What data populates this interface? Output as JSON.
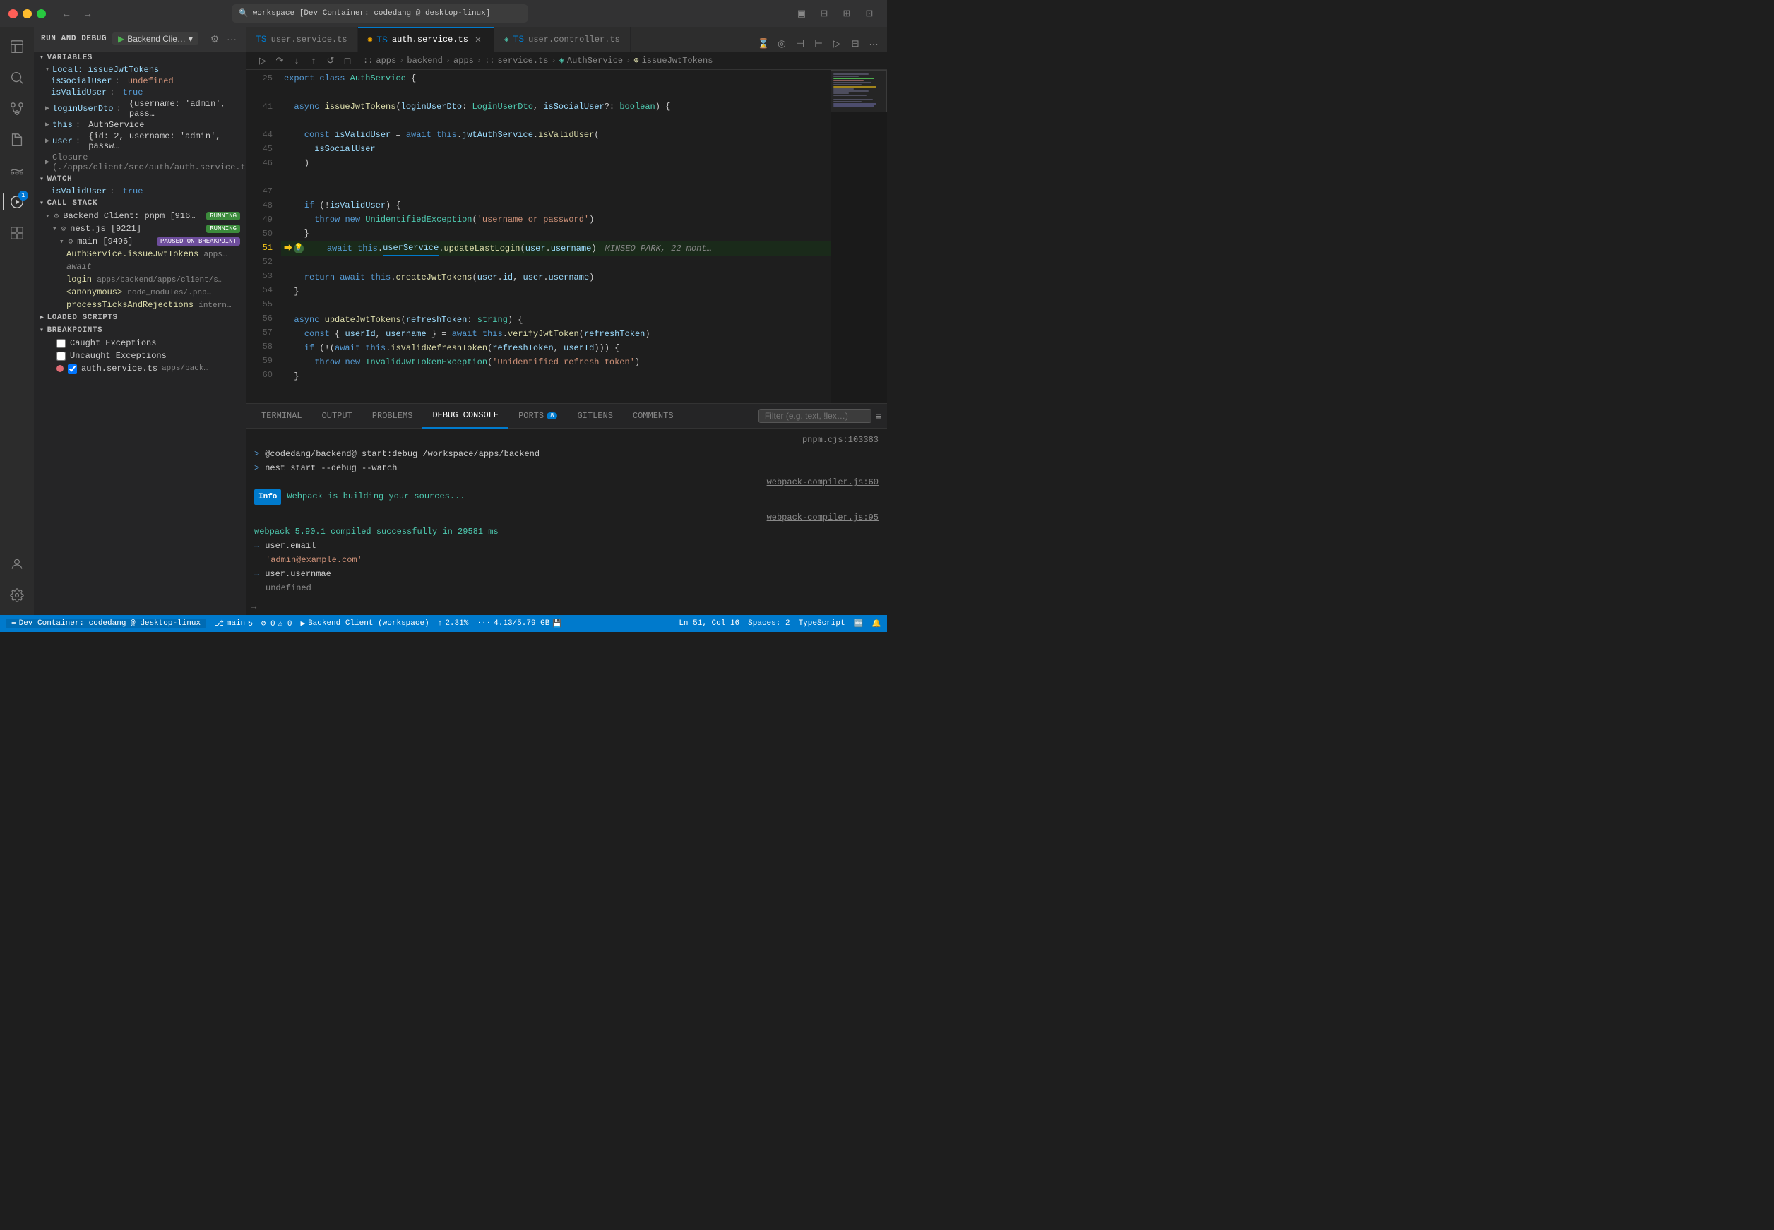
{
  "titlebar": {
    "search_text": "workspace [Dev Container: codedang @ desktop-linux]",
    "nav_back": "←",
    "nav_forward": "→"
  },
  "activity_bar": {
    "icons": [
      {
        "name": "explorer",
        "symbol": "⎘",
        "active": false
      },
      {
        "name": "search",
        "symbol": "🔍",
        "active": false
      },
      {
        "name": "source-control",
        "symbol": "⎇",
        "active": false
      },
      {
        "name": "extensions",
        "symbol": "⊞",
        "active": false
      },
      {
        "name": "testing",
        "symbol": "⚗",
        "active": false
      },
      {
        "name": "docker",
        "symbol": "🐳",
        "active": false
      },
      {
        "name": "run-debug",
        "symbol": "▶",
        "active": true,
        "badge": null
      },
      {
        "name": "extensions2",
        "symbol": "⊡",
        "active": false
      }
    ],
    "bottom_icons": [
      {
        "name": "account",
        "symbol": "👤"
      },
      {
        "name": "settings",
        "symbol": "⚙"
      }
    ]
  },
  "sidebar": {
    "run_debug_label": "RUN AND DEBUG",
    "debug_config": "Backend Clie…",
    "sections": {
      "variables": {
        "title": "VARIABLES",
        "local_title": "Local: issueJwtTokens",
        "items": [
          {
            "name": "isSocialUser",
            "value": "undefined"
          },
          {
            "name": "isValidUser",
            "value": "true"
          },
          {
            "name": "loginUserDto",
            "value": "{username: 'admin', pass…"
          },
          {
            "name": "this",
            "value": "AuthService"
          },
          {
            "name": "user",
            "value": "{id: 2, username: 'admin', passw…"
          },
          {
            "name": "Closure",
            "value": "(./apps/client/src/auth/auth.service.ts)"
          }
        ]
      },
      "watch": {
        "title": "WATCH",
        "items": [
          {
            "expr": "isValidUser",
            "value": "true"
          }
        ]
      },
      "call_stack": {
        "title": "CALL STACK",
        "items": [
          {
            "label": "Backend Client: pnpm [916…",
            "status": "RUNNING",
            "indent": 0
          },
          {
            "label": "nest.js [9221]",
            "status": "RUNNING",
            "indent": 1
          },
          {
            "label": "main [9496]",
            "status": "PAUSED ON BREAKPOINT",
            "indent": 2
          },
          {
            "label": "AuthService.issueJwtTokens",
            "loc": "apps…",
            "indent": 3
          },
          {
            "label": "await",
            "loc": "",
            "indent": 3,
            "italic": true
          },
          {
            "label": "login",
            "loc": "apps/backend/apps/client/s…",
            "indent": 3
          },
          {
            "label": "<anonymous>",
            "loc": "node_modules/.pnp…",
            "indent": 3
          },
          {
            "label": "processTicksAndRejections",
            "loc": "intern…",
            "indent": 3
          }
        ]
      },
      "loaded_scripts": {
        "title": "LOADED SCRIPTS"
      },
      "breakpoints": {
        "title": "BREAKPOINTS",
        "items": [
          {
            "label": "Caught Exceptions",
            "checked": false
          },
          {
            "label": "Uncaught Exceptions",
            "checked": false
          },
          {
            "label": "auth.service.ts",
            "loc": "apps/back…",
            "has_dot": true,
            "checked": true
          }
        ]
      }
    }
  },
  "editor": {
    "tabs": [
      {
        "label": "user.service.ts",
        "active": false,
        "icon": "ts"
      },
      {
        "label": "auth.service.ts",
        "active": true,
        "icon": "ts",
        "modified": false
      },
      {
        "label": "user.controller.ts",
        "active": false,
        "icon": "ts"
      }
    ],
    "breadcrumb": [
      "apps",
      "backend",
      "apps",
      "service.ts",
      "AuthService",
      "issueJwtTokens"
    ],
    "lines": [
      {
        "num": 25,
        "content": "export class AuthService {",
        "tokens": [
          {
            "t": "kw",
            "v": "export"
          },
          {
            "t": "op",
            "v": " "
          },
          {
            "t": "kw",
            "v": "class"
          },
          {
            "t": "op",
            "v": " "
          },
          {
            "t": "cls",
            "v": "AuthService"
          },
          {
            "t": "op",
            "v": " {"
          }
        ]
      },
      {
        "num": 41,
        "content": "  async issueJwtTokens(loginUserDto: LoginUserDto, isSocialUser?: boolean) {",
        "tokens": [
          {
            "t": "op",
            "v": "  "
          },
          {
            "t": "kw",
            "v": "async"
          },
          {
            "t": "op",
            "v": " "
          },
          {
            "t": "fn",
            "v": "issueJwtTokens"
          },
          {
            "t": "op",
            "v": "("
          },
          {
            "t": "param",
            "v": "loginUserDto"
          },
          {
            "t": "op",
            "v": ": "
          },
          {
            "t": "type",
            "v": "LoginUserDto"
          },
          {
            "t": "op",
            "v": ", "
          },
          {
            "t": "param",
            "v": "isSocialUser"
          },
          {
            "t": "op",
            "v": "?: "
          },
          {
            "t": "type",
            "v": "boolean"
          },
          {
            "t": "op",
            "v": ") {"
          }
        ]
      },
      {
        "num": 44,
        "content": "    const isValidUser = await this.jwtAuthService.isValidUser(",
        "tokens": [
          {
            "t": "op",
            "v": "    "
          },
          {
            "t": "kw",
            "v": "const"
          },
          {
            "t": "op",
            "v": " "
          },
          {
            "t": "prop",
            "v": "isValidUser"
          },
          {
            "t": "op",
            "v": " = "
          },
          {
            "t": "kw",
            "v": "await"
          },
          {
            "t": "op",
            "v": " "
          },
          {
            "t": "kw",
            "v": "this"
          },
          {
            "t": "op",
            "v": "."
          },
          {
            "t": "prop",
            "v": "jwtAuthService"
          },
          {
            "t": "op",
            "v": "."
          },
          {
            "t": "fn",
            "v": "isValidUser"
          },
          {
            "t": "op",
            "v": "("
          }
        ]
      },
      {
        "num": 45,
        "content": "      isSocialUser",
        "tokens": [
          {
            "t": "op",
            "v": "      "
          },
          {
            "t": "prop",
            "v": "isSocialUser"
          }
        ]
      },
      {
        "num": 46,
        "content": "    )",
        "tokens": [
          {
            "t": "op",
            "v": "    )"
          }
        ]
      },
      {
        "num": 47,
        "content": "",
        "tokens": []
      },
      {
        "num": 48,
        "content": "    if (!isValidUser) {",
        "tokens": [
          {
            "t": "op",
            "v": "    "
          },
          {
            "t": "kw",
            "v": "if"
          },
          {
            "t": "op",
            "v": " (!"
          },
          {
            "t": "prop",
            "v": "isValidUser"
          },
          {
            "t": "op",
            "v": ") {"
          }
        ]
      },
      {
        "num": 49,
        "content": "      throw new UnidentifiedException('username or password')",
        "tokens": [
          {
            "t": "op",
            "v": "      "
          },
          {
            "t": "kw",
            "v": "throw"
          },
          {
            "t": "op",
            "v": " "
          },
          {
            "t": "kw",
            "v": "new"
          },
          {
            "t": "op",
            "v": " "
          },
          {
            "t": "cls",
            "v": "UnidentifiedException"
          },
          {
            "t": "op",
            "v": "("
          },
          {
            "t": "str",
            "v": "'username or password'"
          },
          {
            "t": "op",
            "v": ")"
          }
        ]
      },
      {
        "num": 50,
        "content": "    }",
        "tokens": [
          {
            "t": "op",
            "v": "    }"
          }
        ]
      },
      {
        "num": 51,
        "content": "    await this.userService.updateLastLogin(user.username)",
        "breakpoint": true,
        "debug_line": true,
        "inline_hint": "MINSEO PARK, 22 mont…"
      },
      {
        "num": 52,
        "content": "",
        "tokens": []
      },
      {
        "num": 53,
        "content": "    return await this.createJwtTokens(user.id, user.username)",
        "tokens": [
          {
            "t": "op",
            "v": "    "
          },
          {
            "t": "kw",
            "v": "return"
          },
          {
            "t": "op",
            "v": " "
          },
          {
            "t": "kw",
            "v": "await"
          },
          {
            "t": "op",
            "v": " "
          },
          {
            "t": "kw",
            "v": "this"
          },
          {
            "t": "op",
            "v": "."
          },
          {
            "t": "fn",
            "v": "createJwtTokens"
          },
          {
            "t": "op",
            "v": "("
          },
          {
            "t": "prop",
            "v": "user"
          },
          {
            "t": "op",
            "v": "."
          },
          {
            "t": "prop",
            "v": "id"
          },
          {
            "t": "op",
            "v": ", "
          },
          {
            "t": "prop",
            "v": "user"
          },
          {
            "t": "op",
            "v": "."
          },
          {
            "t": "prop",
            "v": "username"
          },
          {
            "t": "op",
            "v": ")"
          }
        ]
      },
      {
        "num": 54,
        "content": "  }",
        "tokens": [
          {
            "t": "op",
            "v": "  }"
          }
        ]
      },
      {
        "num": 55,
        "content": "",
        "tokens": []
      },
      {
        "num": 56,
        "content": "  async updateJwtTokens(refreshToken: string) {",
        "tokens": [
          {
            "t": "op",
            "v": "  "
          },
          {
            "t": "kw",
            "v": "async"
          },
          {
            "t": "op",
            "v": " "
          },
          {
            "t": "fn",
            "v": "updateJwtTokens"
          },
          {
            "t": "op",
            "v": "("
          },
          {
            "t": "param",
            "v": "refreshToken"
          },
          {
            "t": "op",
            "v": ": "
          },
          {
            "t": "type",
            "v": "string"
          },
          {
            "t": "op",
            "v": ") {"
          }
        ]
      },
      {
        "num": 57,
        "content": "    const { userId, username } = await this.verifyJwtToken(refreshToken)",
        "tokens": [
          {
            "t": "op",
            "v": "    "
          },
          {
            "t": "kw",
            "v": "const"
          },
          {
            "t": "op",
            "v": " { "
          },
          {
            "t": "prop",
            "v": "userId"
          },
          {
            "t": "op",
            "v": ", "
          },
          {
            "t": "prop",
            "v": "username"
          },
          {
            "t": "op",
            "v": " } = "
          },
          {
            "t": "kw",
            "v": "await"
          },
          {
            "t": "op",
            "v": " "
          },
          {
            "t": "kw",
            "v": "this"
          },
          {
            "t": "op",
            "v": "."
          },
          {
            "t": "fn",
            "v": "verifyJwtToken"
          },
          {
            "t": "op",
            "v": "("
          },
          {
            "t": "prop",
            "v": "refreshToken"
          },
          {
            "t": "op",
            "v": ")"
          }
        ]
      },
      {
        "num": 58,
        "content": "    if (!(await this.isValidRefreshToken(refreshToken, userId))) {",
        "tokens": [
          {
            "t": "op",
            "v": "    "
          },
          {
            "t": "kw",
            "v": "if"
          },
          {
            "t": "op",
            "v": " (!("
          },
          {
            "t": "kw",
            "v": "await"
          },
          {
            "t": "op",
            "v": " "
          },
          {
            "t": "kw",
            "v": "this"
          },
          {
            "t": "op",
            "v": "."
          },
          {
            "t": "fn",
            "v": "isValidRefreshToken"
          },
          {
            "t": "op",
            "v": "("
          },
          {
            "t": "prop",
            "v": "refreshToken"
          },
          {
            "t": "op",
            "v": ", "
          },
          {
            "t": "prop",
            "v": "userId"
          },
          {
            "t": "op",
            "v": "))) {"
          }
        ]
      },
      {
        "num": 59,
        "content": "      throw new InvalidJwtTokenException('Unidentified refresh token')",
        "tokens": [
          {
            "t": "op",
            "v": "      "
          },
          {
            "t": "kw",
            "v": "throw"
          },
          {
            "t": "op",
            "v": " "
          },
          {
            "t": "kw",
            "v": "new"
          },
          {
            "t": "op",
            "v": " "
          },
          {
            "t": "cls",
            "v": "InvalidJwtTokenException"
          },
          {
            "t": "op",
            "v": "("
          },
          {
            "t": "str",
            "v": "'Unidentified refresh token'"
          },
          {
            "t": "op",
            "v": ")"
          }
        ]
      },
      {
        "num": 60,
        "content": "  }",
        "tokens": [
          {
            "t": "op",
            "v": "  }"
          }
        ]
      }
    ]
  },
  "panel": {
    "tabs": [
      {
        "label": "TERMINAL",
        "active": false
      },
      {
        "label": "OUTPUT",
        "active": false
      },
      {
        "label": "PROBLEMS",
        "active": false
      },
      {
        "label": "DEBUG CONSOLE",
        "active": true
      },
      {
        "label": "PORTS",
        "active": false,
        "badge": "8"
      },
      {
        "label": "GITLENS",
        "active": false
      },
      {
        "label": "COMMENTS",
        "active": false
      }
    ],
    "filter_placeholder": "Filter (e.g. text, !lex…)",
    "console_lines": [
      {
        "type": "link",
        "text": "pnpm.cjs:103383"
      },
      {
        "type": "prompt",
        "prompt": ">",
        "text": "@codedang/backend@ start:debug /workspace/apps/backend"
      },
      {
        "type": "prompt",
        "prompt": ">",
        "text": "nest start --debug --watch"
      },
      {
        "type": "link",
        "text": "webpack-compiler.js:60"
      },
      {
        "type": "info",
        "badge": "Info",
        "text": "Webpack is building your sources..."
      },
      {
        "type": "normal",
        "text": ""
      },
      {
        "type": "success_link",
        "text": "webpack-compiler.js:95"
      },
      {
        "type": "success",
        "text": "webpack 5.90.1 compiled successfully in 29581 ms"
      },
      {
        "type": "arrow",
        "text": "user.email"
      },
      {
        "type": "indent",
        "text": "'admin@example.com'"
      },
      {
        "type": "arrow",
        "text": "user.usernmae"
      },
      {
        "type": "indent",
        "text": "undefined"
      }
    ],
    "input_prompt": "→"
  },
  "status_bar": {
    "container_label": "Dev Container: codedang @ desktop-linux",
    "branch": "main",
    "sync": "↻",
    "errors": "⊘ 0",
    "warnings": "⚠ 0",
    "backend_client": "Backend Client (workspace)",
    "cpu": "2.31%",
    "memory": "4.13/5.79 GB",
    "ln_col": "Ln 51, Col 16",
    "spaces": "Spaces: 2",
    "language": "TypeScript",
    "bell": "🔔",
    "remote_icon": "≡"
  }
}
